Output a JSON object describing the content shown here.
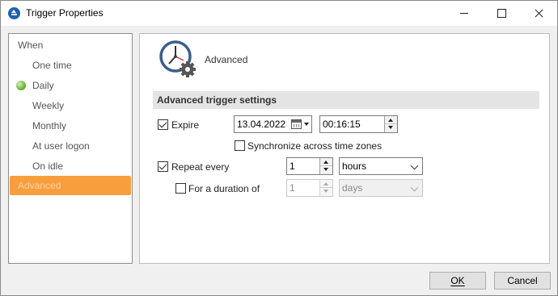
{
  "window": {
    "title": "Trigger Properties"
  },
  "sidebar": {
    "heading": "When",
    "items": [
      {
        "label": "One time"
      },
      {
        "label": "Daily",
        "active_indicator": "green-dot-icon"
      },
      {
        "label": "Weekly"
      },
      {
        "label": "Monthly"
      },
      {
        "label": "At user logon"
      },
      {
        "label": "On idle"
      },
      {
        "label": "Advanced",
        "selected": true
      }
    ]
  },
  "panel": {
    "header_title": "Advanced",
    "header_icon": "clock-gear-icon",
    "section_title": "Advanced trigger settings",
    "expire": {
      "label": "Expire",
      "checked": true,
      "date": "13.04.2022",
      "time": "00:16:15"
    },
    "sync": {
      "label": "Synchronize across time zones",
      "checked": false
    },
    "repeat": {
      "label": "Repeat every",
      "checked": true,
      "value": "1",
      "unit": "hours"
    },
    "duration": {
      "label": "For a duration of",
      "checked": false,
      "value": "1",
      "unit": "days",
      "disabled": true
    }
  },
  "buttons": {
    "ok": "OK",
    "cancel": "Cancel"
  },
  "colors": {
    "selected_bg": "#f89e3c",
    "section_bg": "#e4e4e4",
    "accent": "#1e62b0"
  }
}
